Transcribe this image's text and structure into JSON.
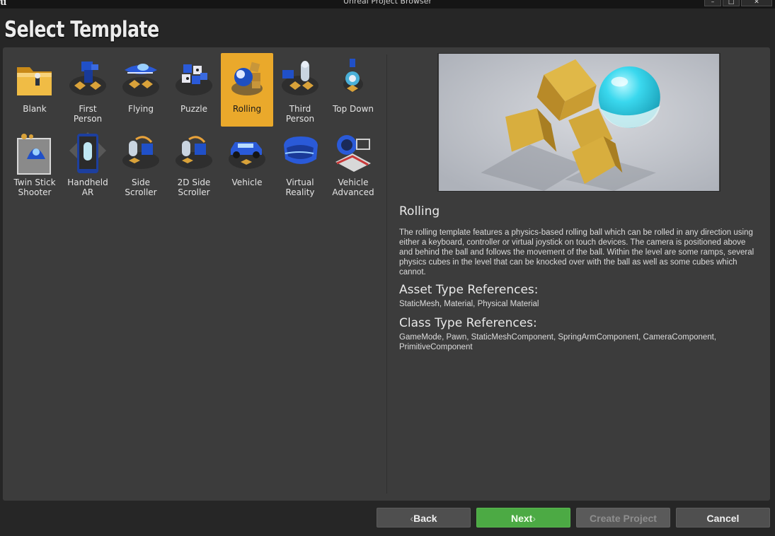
{
  "window": {
    "title": "Unreal Project Browser",
    "logo": "u",
    "minimize_glyph": "–",
    "maximize_glyph": "□",
    "close_glyph": "✕"
  },
  "page": {
    "title": "Select Template"
  },
  "templates": [
    {
      "label": "Blank",
      "icon": "folder-icon"
    },
    {
      "label": "First\nPerson",
      "icon": "first-person-icon"
    },
    {
      "label": "Flying",
      "icon": "flying-icon"
    },
    {
      "label": "Puzzle",
      "icon": "puzzle-icon"
    },
    {
      "label": "Rolling",
      "icon": "rolling-icon",
      "selected": true
    },
    {
      "label": "Third\nPerson",
      "icon": "third-person-icon"
    },
    {
      "label": "Top Down",
      "icon": "top-down-icon"
    },
    {
      "label": "Twin Stick\nShooter",
      "icon": "twin-stick-icon"
    },
    {
      "label": "Handheld\nAR",
      "icon": "handheld-ar-icon"
    },
    {
      "label": "Side\nScroller",
      "icon": "side-scroller-icon"
    },
    {
      "label": "2D Side\nScroller",
      "icon": "2d-side-scroller-icon"
    },
    {
      "label": "Vehicle",
      "icon": "vehicle-icon"
    },
    {
      "label": "Virtual\nReality",
      "icon": "vr-headset-icon"
    },
    {
      "label": "Vehicle\nAdvanced",
      "icon": "vehicle-advanced-icon"
    }
  ],
  "details": {
    "name": "Rolling",
    "description": "The rolling template features a physics-based rolling ball which can be rolled in any direction using either a keyboard, controller or virtual joystick on touch devices. The camera is positioned above and behind the ball and follows the movement of the ball. Within the level are some ramps, several physics cubes in the level that can be knocked over with the ball as well as some cubes which cannot.",
    "asset_heading": "Asset Type References:",
    "asset_refs": "StaticMesh, Material, Physical Material",
    "class_heading": "Class Type References:",
    "class_refs": "GameMode, Pawn, StaticMeshComponent, SpringArmComponent, CameraComponent, PrimitiveComponent"
  },
  "footer": {
    "back": "Back",
    "next": "Next",
    "create": "Create Project",
    "cancel": "Cancel"
  },
  "colors": {
    "selected": "#eaa92b",
    "next_button": "#4caa44",
    "panel": "#3c3c3c"
  }
}
